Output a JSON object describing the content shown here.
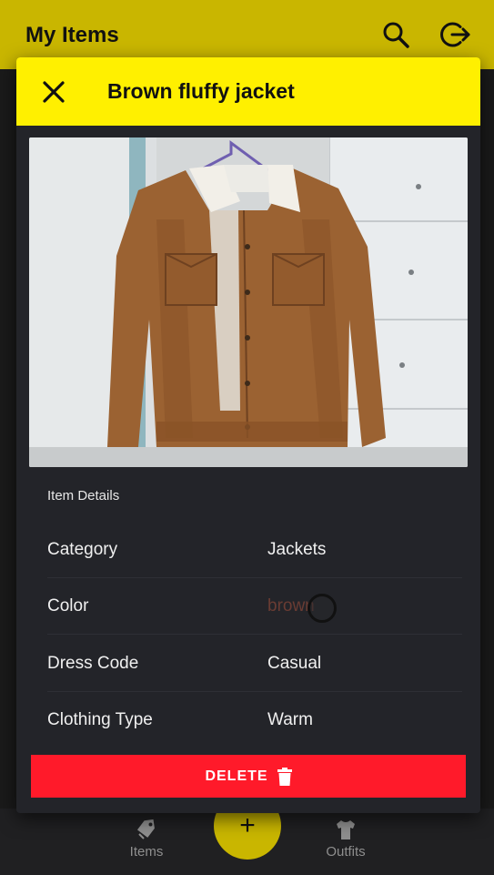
{
  "app_bar": {
    "title": "My Items",
    "search_icon": "search-icon",
    "logout_icon": "logout-icon",
    "color": "#c9b600"
  },
  "dialog": {
    "title": "Brown fluffy jacket",
    "close_icon": "close-icon",
    "header_color": "#fff000",
    "image_alt": "brown corduroy jacket with sherpa collar on hanger",
    "details_heading": "Item Details",
    "details": [
      {
        "label": "Category",
        "value": "Jackets"
      },
      {
        "label": "Color",
        "value": "brown"
      },
      {
        "label": "Dress Code",
        "value": "Casual"
      },
      {
        "label": "Clothing Type",
        "value": "Warm"
      }
    ],
    "delete_label": "DELETE",
    "delete_icon": "trash-icon",
    "delete_color": "#ff1a2a"
  },
  "bottom_nav": {
    "items": [
      {
        "label": "Items",
        "icon": "tag-icon"
      },
      {
        "label": "Outfits",
        "icon": "shirt-icon"
      }
    ],
    "fab_label": "+",
    "fab_color": "#c9b600"
  }
}
